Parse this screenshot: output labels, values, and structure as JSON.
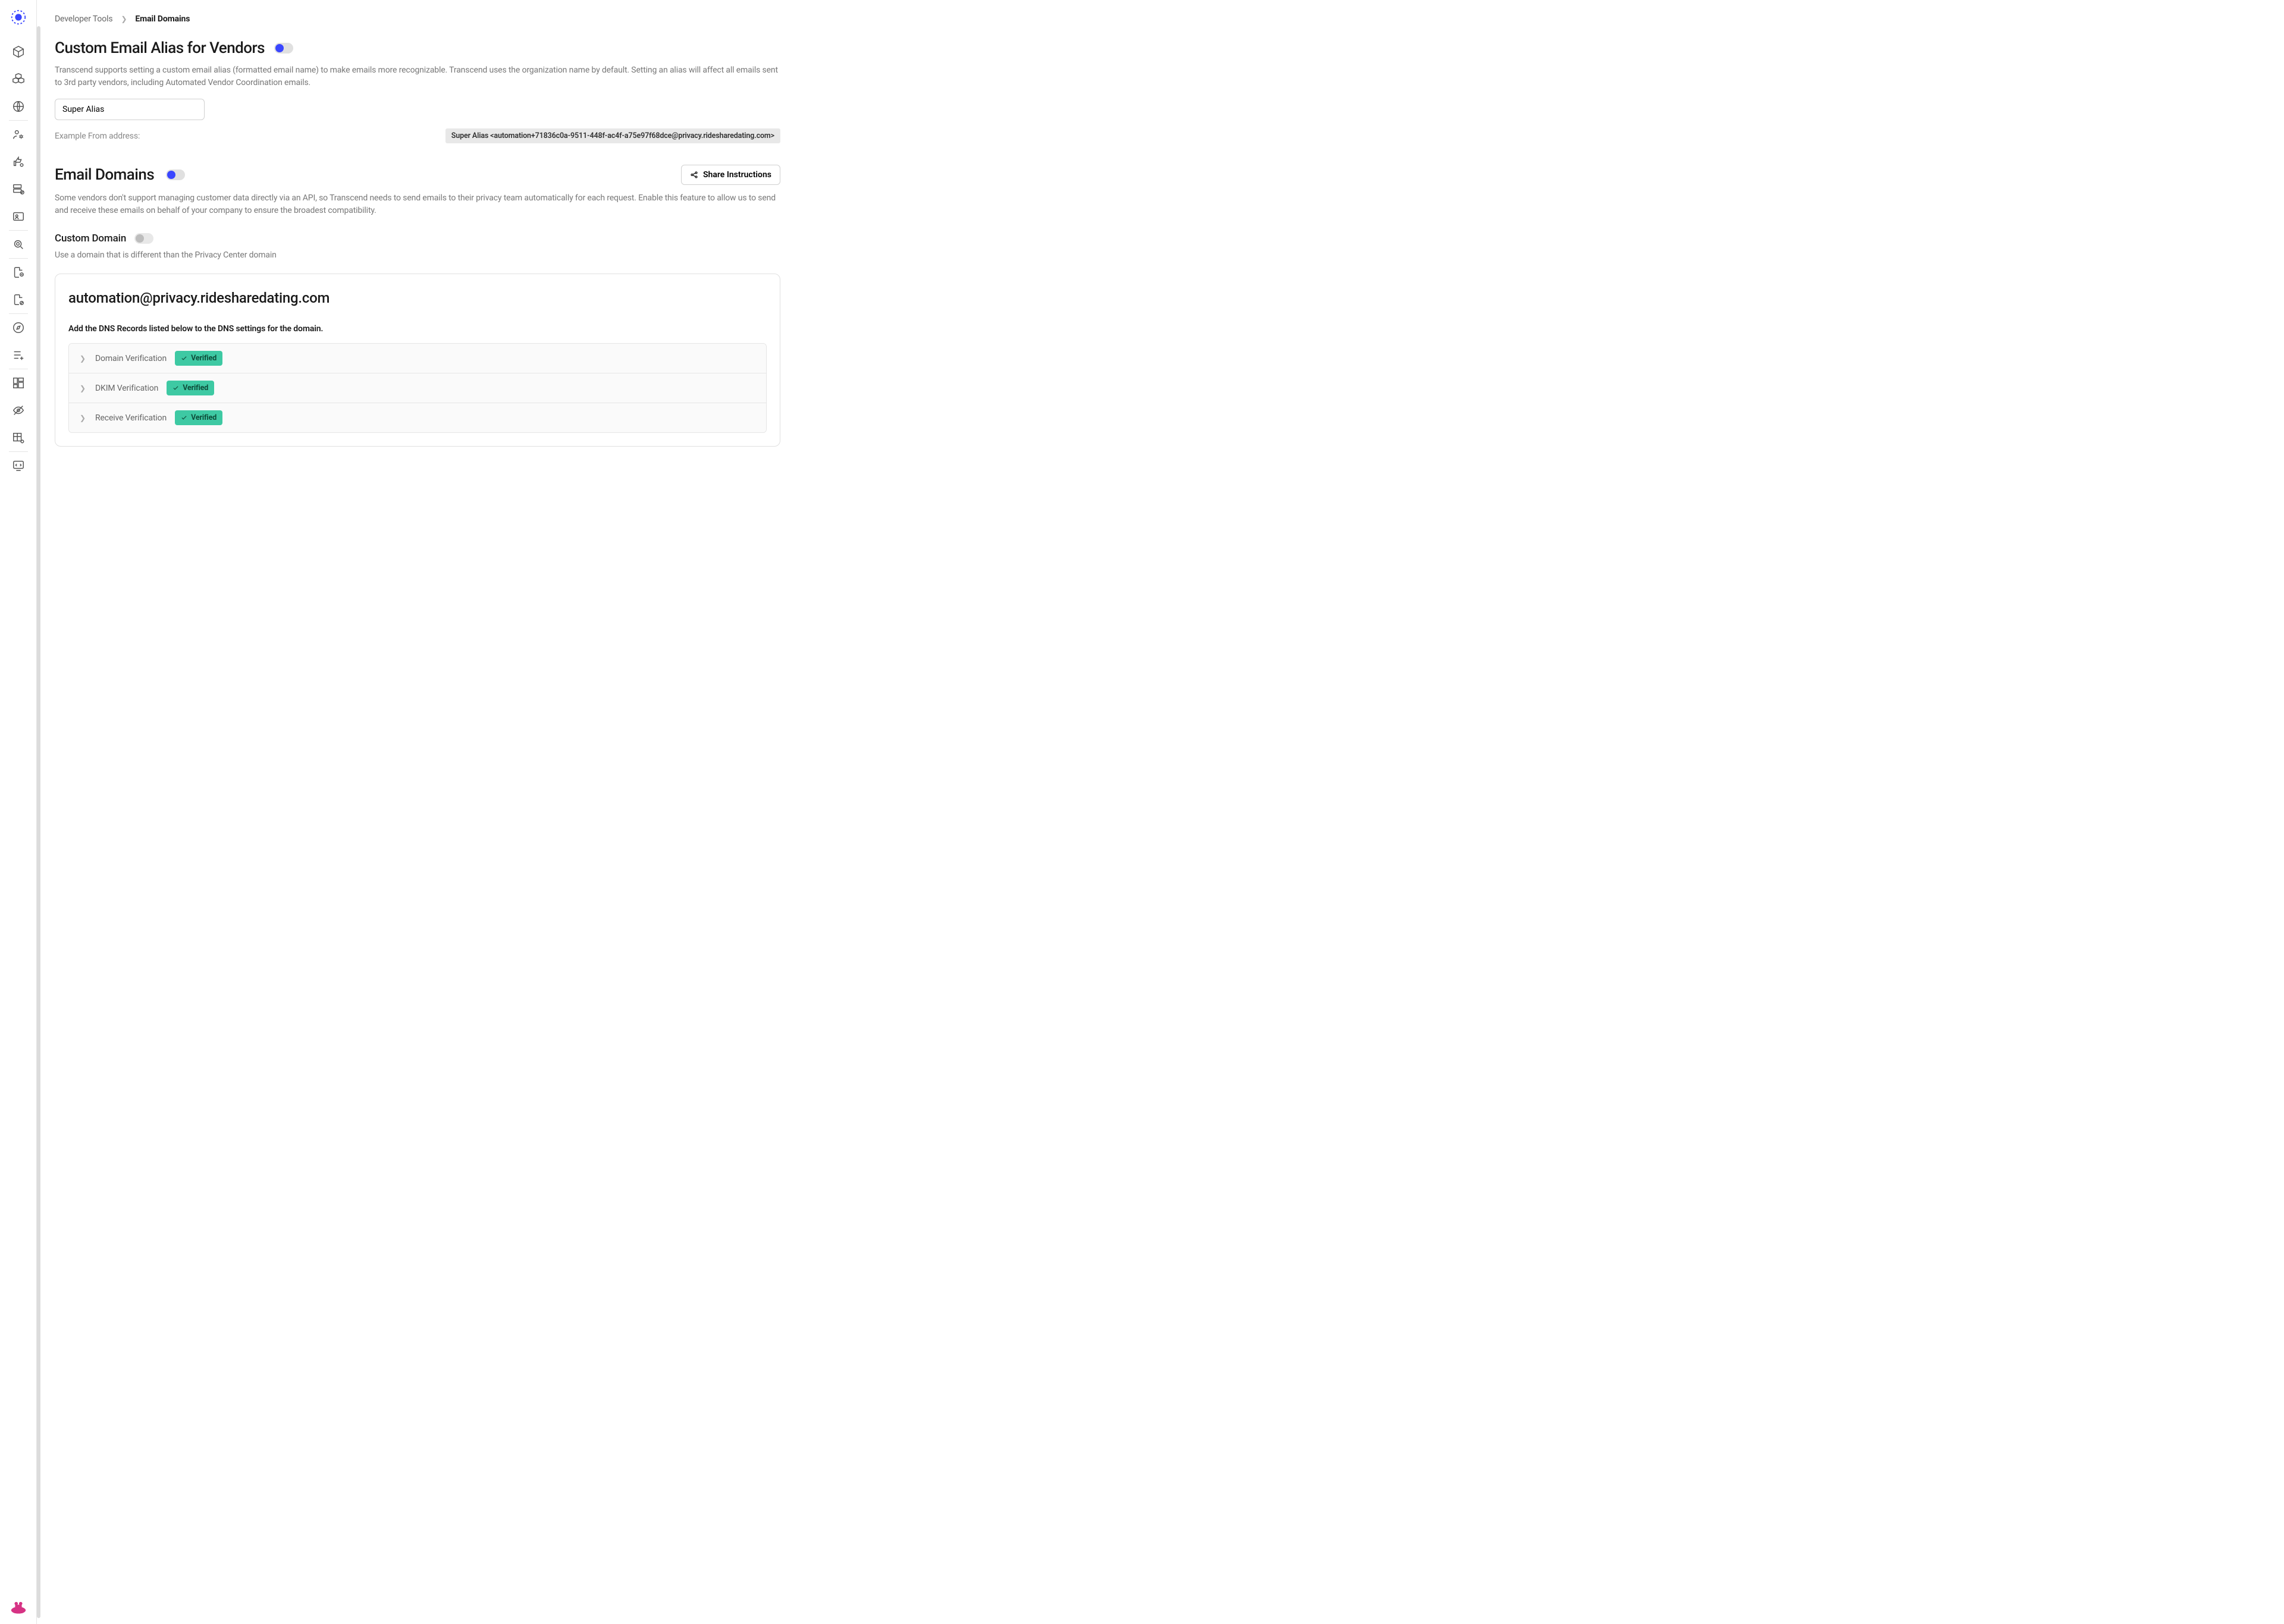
{
  "breadcrumb": {
    "parent": "Developer Tools",
    "current": "Email Domains"
  },
  "alias_section": {
    "title": "Custom Email Alias for Vendors",
    "toggle_on": true,
    "description": "Transcend supports setting a custom email alias (formatted email name) to make emails more recognizable. Transcend uses the organization name by default. Setting an alias will affect all emails sent to 3rd party vendors, including Automated Vendor Coordination emails.",
    "input_value": "Super Alias",
    "example_label": "Example From address:",
    "example_value": "Super Alias <automation+71836c0a-9511-448f-ac4f-a75e97f68dce@privacy.ridesharedating.com>"
  },
  "domains_section": {
    "title": "Email Domains",
    "toggle_on": true,
    "share_button": "Share Instructions",
    "description": "Some vendors don't support managing customer data directly via an API, so Transcend needs to send emails to their privacy team automatically for each request. Enable this feature to allow us to send and receive these emails on behalf of your company to ensure the broadest compatibility."
  },
  "custom_domain": {
    "title": "Custom Domain",
    "toggle_on": false,
    "description": "Use a domain that is different than the Privacy Center domain"
  },
  "domain_panel": {
    "email": "automation@privacy.ridesharedating.com",
    "instruction": "Add the DNS Records listed below to the DNS settings for the domain.",
    "rows": [
      {
        "label": "Domain Verification",
        "status": "Verified"
      },
      {
        "label": "DKIM Verification",
        "status": "Verified"
      },
      {
        "label": "Receive Verification",
        "status": "Verified"
      }
    ]
  }
}
